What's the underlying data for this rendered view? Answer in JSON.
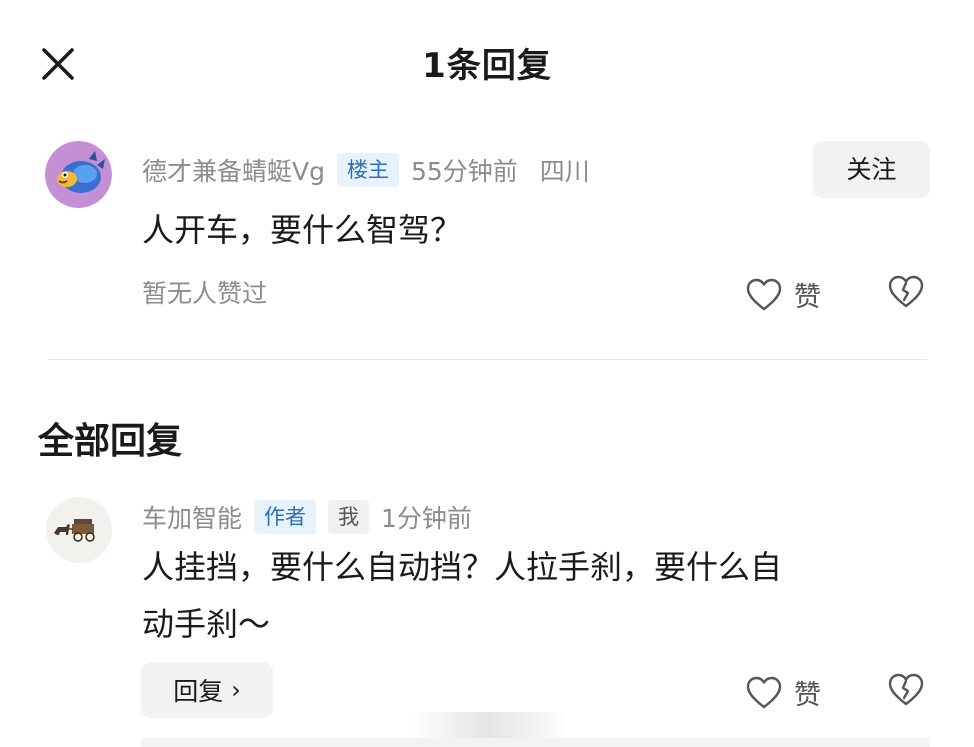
{
  "header": {
    "title": "1条回复",
    "close_icon": "close-icon"
  },
  "main_comment": {
    "author": "德才兼备蜻蜓Vg",
    "badge": "楼主",
    "time": "55分钟前",
    "location": "四川",
    "follow_label": "关注",
    "text": "人开车，要什么智驾？",
    "likes_status": "暂无人赞过",
    "like_label": "赞",
    "avatar_icon": "pufferfish-avatar",
    "like_icon": "heart-outline-icon",
    "dislike_icon": "broken-heart-icon"
  },
  "replies_section": {
    "title": "全部回复",
    "replies": [
      {
        "author": "车加智能",
        "badges": [
          "作者",
          "我"
        ],
        "time": "1分钟前",
        "text_line1": "人挂挡，要什么自动挡？人拉手刹，要什么自",
        "text_line2": "动手刹～",
        "reply_label": "回复",
        "like_label": "赞",
        "avatar_icon": "horse-carriage-avatar"
      }
    ]
  },
  "colors": {
    "badge_blue_text": "#2b6fb6",
    "badge_blue_bg": "#e8f2fc",
    "meta_gray": "#8c8c8c"
  }
}
